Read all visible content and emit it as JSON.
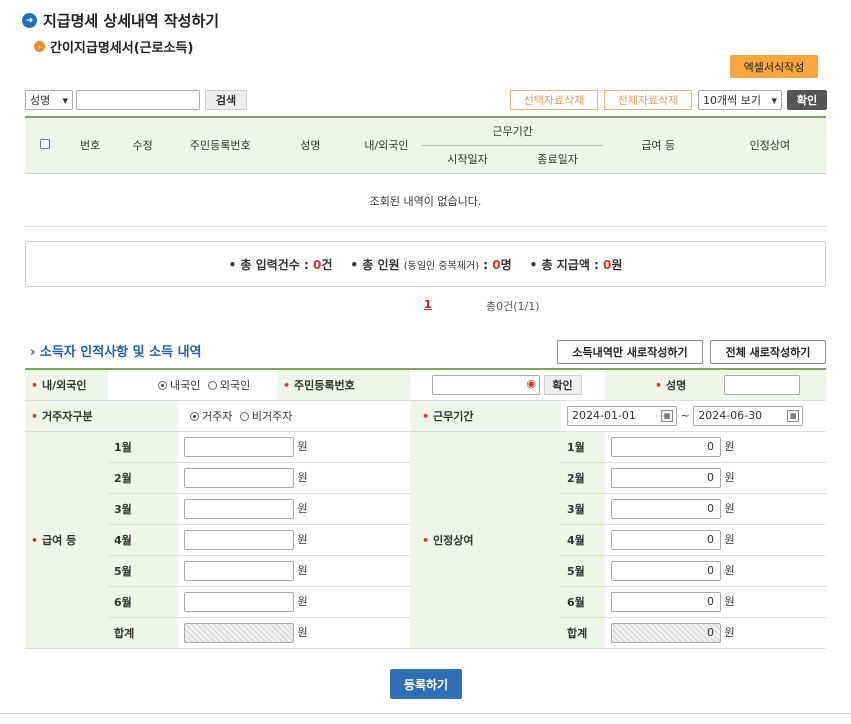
{
  "header": {
    "title": "지급명세 상세내역 작성하기",
    "subtitle": "간이지급명세서(근로소득)",
    "excel_button": "엑셀서식작성"
  },
  "search": {
    "field_selected": "성명",
    "search_button": "검색",
    "delete_selected": "선택자료삭제",
    "delete_all": "전체자료삭제",
    "page_size": "10개씩 보기",
    "confirm": "확인"
  },
  "list": {
    "headers": {
      "no": "번호",
      "edit": "수정",
      "rrn": "주민등록번호",
      "name": "성명",
      "nationality": "내/외국인",
      "period": "근무기간",
      "start": "시작일자",
      "end": "종료일자",
      "salary": "급여 등",
      "bonus": "인정상여"
    },
    "empty_message": "조회된 내역이 없습니다."
  },
  "summary": {
    "count_label": "총 입력건수 : ",
    "count_value": "0",
    "count_unit": "건",
    "people_label": "총 인원 ",
    "people_note": "(동일인 중복제거)",
    "people_colon": " : ",
    "people_value": "0",
    "people_unit": "명",
    "paid_label": "총 지급액 : ",
    "paid_value": "0",
    "paid_unit": "원"
  },
  "pager": {
    "current": "1",
    "total": "총0건(1/1)"
  },
  "income_section": {
    "title": "소득자 인적사항 및 소득 내역",
    "btn_new_income": "소득내역만 새로작성하기",
    "btn_new_all": "전체 새로작성하기",
    "nationality_label": "내/외국인",
    "domestic": "내국인",
    "foreign": "외국인",
    "rrn_label": "주민등록번호",
    "rrn_confirm": "확인",
    "name_label": "성명",
    "residence_label": "거주자구분",
    "resident": "거주자",
    "nonresident": "비거주자",
    "period_label": "근무기간",
    "start_date": "2024-01-01",
    "end_date": "2024-06-30",
    "tilde": "~",
    "salary_label": "급여 등",
    "bonus_label": "인정상여",
    "won": "원",
    "months": [
      "1월",
      "2월",
      "3월",
      "4월",
      "5월",
      "6월"
    ],
    "total_label": "합계",
    "bonus_values": [
      "0",
      "0",
      "0",
      "0",
      "0",
      "0"
    ],
    "bonus_total": "0"
  },
  "footer": {
    "submit": "등록하기"
  }
}
